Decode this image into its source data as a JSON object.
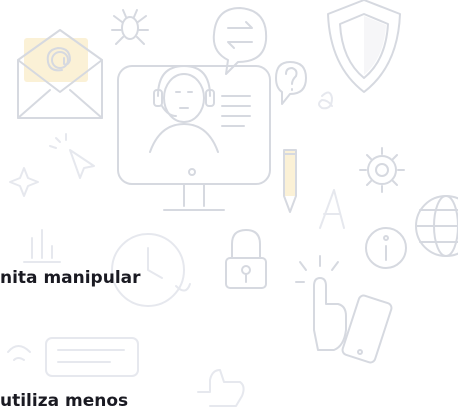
{
  "text": {
    "line1": "nita manipular",
    "line2": "utiliza menos"
  },
  "colors": {
    "background": "#ffffff",
    "line_art": "#d6d9e0",
    "accent_yellow": "#fbf1d6",
    "text": "#1a1a22"
  },
  "icons": [
    "envelope-icon",
    "bug-icon",
    "chat-swap-icon",
    "shield-icon",
    "support-agent-monitor-icon",
    "question-bubble-icon",
    "pencil-icon",
    "gear-icon",
    "sparkle-icon",
    "cursor-icon",
    "font-a-icon",
    "globe-icon",
    "bar-chart-icon",
    "clock-24-icon",
    "padlock-icon",
    "info-icon",
    "tap-hand-icon",
    "smartphone-icon",
    "thumbs-up-icon",
    "wifi-icon"
  ]
}
